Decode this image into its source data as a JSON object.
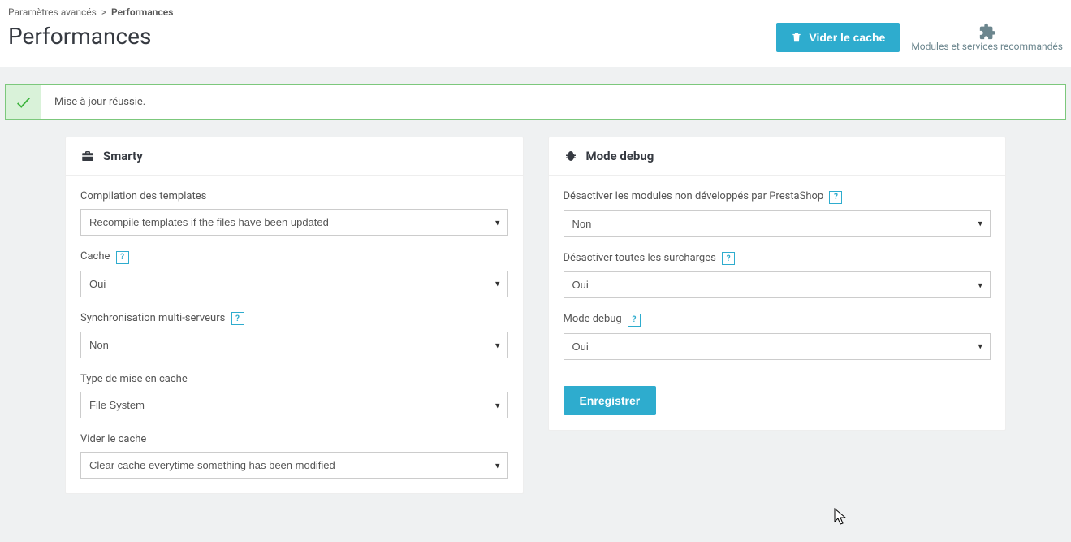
{
  "breadcrumb": {
    "parent": "Paramètres avancés",
    "sep": ">",
    "current": "Performances"
  },
  "page_title": "Performances",
  "header": {
    "clear_cache_label": "Vider le cache",
    "modules_label": "Modules et services recommandés"
  },
  "alert": {
    "message": "Mise à jour réussie."
  },
  "smarty_panel": {
    "title": "Smarty",
    "fields": {
      "template_compilation": {
        "label": "Compilation des templates",
        "value": "Recompile templates if the files have been updated"
      },
      "cache": {
        "label": "Cache",
        "value": "Oui",
        "help": "?"
      },
      "multi_server": {
        "label": "Synchronisation multi-serveurs",
        "value": "Non",
        "help": "?"
      },
      "cache_type": {
        "label": "Type de mise en cache",
        "value": "File System"
      },
      "clear_cache": {
        "label": "Vider le cache",
        "value": "Clear cache everytime something has been modified"
      }
    }
  },
  "debug_panel": {
    "title": "Mode debug",
    "fields": {
      "disable_non_ps": {
        "label": "Désactiver les modules non développés par PrestaShop",
        "value": "Non",
        "help": "?"
      },
      "disable_overrides": {
        "label": "Désactiver toutes les surcharges",
        "value": "Oui",
        "help": "?"
      },
      "debug_mode": {
        "label": "Mode debug",
        "value": "Oui",
        "help": "?"
      }
    },
    "save_label": "Enregistrer"
  }
}
